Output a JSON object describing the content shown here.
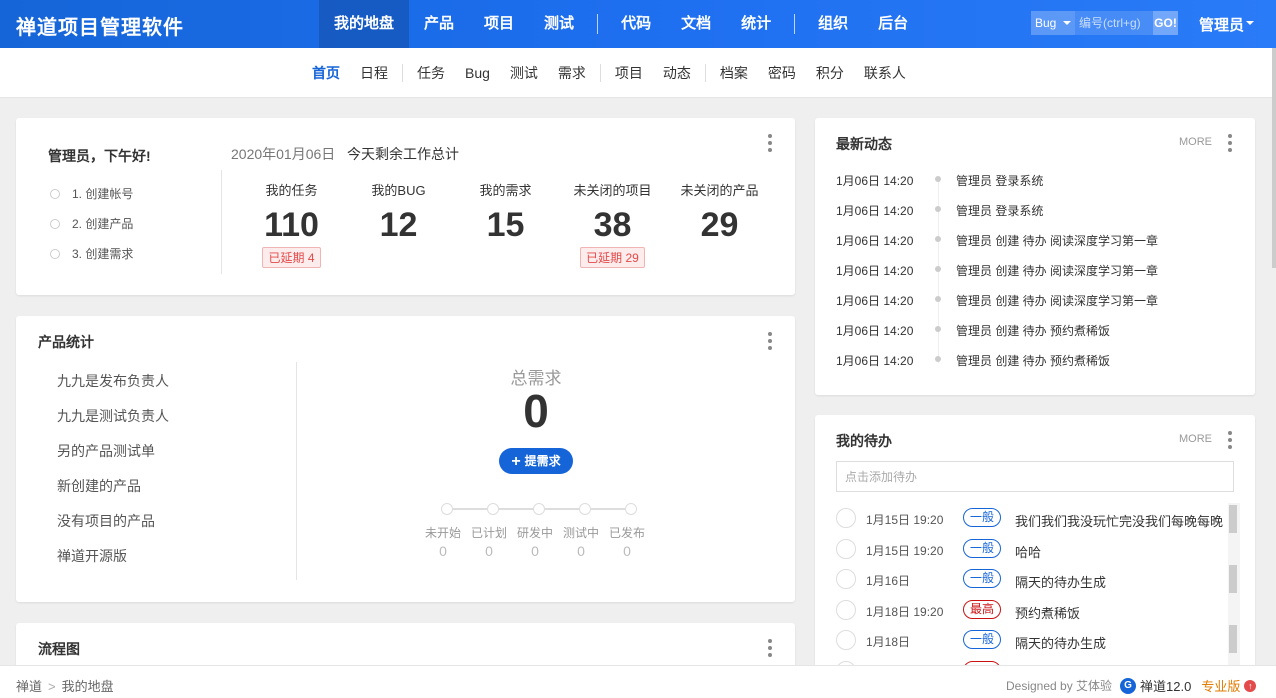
{
  "app": {
    "brand": "禅道项目管理软件"
  },
  "main_nav": [
    {
      "label": "我的地盘",
      "active": true
    },
    {
      "label": "产品"
    },
    {
      "label": "项目"
    },
    {
      "label": "测试"
    },
    {
      "label": "代码"
    },
    {
      "label": "文档"
    },
    {
      "label": "统计"
    },
    {
      "label": "组织"
    },
    {
      "label": "后台"
    }
  ],
  "search": {
    "type": "Bug",
    "placeholder": "编号(ctrl+g)",
    "go_label": "GO!"
  },
  "user": {
    "name": "管理员"
  },
  "sub_nav": [
    {
      "label": "首页",
      "active": true
    },
    {
      "label": "日程"
    },
    {
      "label": "任务"
    },
    {
      "label": "Bug"
    },
    {
      "label": "测试"
    },
    {
      "label": "需求"
    },
    {
      "label": "项目"
    },
    {
      "label": "动态"
    },
    {
      "label": "档案"
    },
    {
      "label": "密码"
    },
    {
      "label": "积分"
    },
    {
      "label": "联系人"
    }
  ],
  "welcome": {
    "greeting": "管理员，下午好!",
    "date": "2020年01月06日",
    "today_total": "今天剩余工作总计",
    "steps": [
      "1. 创建帐号",
      "2. 创建产品",
      "3. 创建需求"
    ],
    "stats": [
      {
        "label": "我的任务",
        "value": "110",
        "delay": "已延期 4"
      },
      {
        "label": "我的BUG",
        "value": "12",
        "delay": ""
      },
      {
        "label": "我的需求",
        "value": "15",
        "delay": ""
      },
      {
        "label": "未关闭的项目",
        "value": "38",
        "delay": "已延期 29"
      },
      {
        "label": "未关闭的产品",
        "value": "29",
        "delay": ""
      }
    ]
  },
  "product_stats": {
    "title": "产品统计",
    "products": [
      "九九是发布负责人",
      "九九是测试负责人",
      "另的产品测试单",
      "新创建的产品",
      "没有项目的产品",
      "禅道开源版"
    ],
    "total_label": "总需求",
    "total_value": "0",
    "add_story_label": "提需求",
    "stages": [
      {
        "label": "未开始",
        "value": "0"
      },
      {
        "label": "已计划",
        "value": "0"
      },
      {
        "label": "研发中",
        "value": "0"
      },
      {
        "label": "测试中",
        "value": "0"
      },
      {
        "label": "已发布",
        "value": "0"
      }
    ]
  },
  "flow": {
    "title": "流程图"
  },
  "dynamics": {
    "title": "最新动态",
    "more": "MORE",
    "items": [
      {
        "time": "1月06日 14:20",
        "content": "管理员 登录系统"
      },
      {
        "time": "1月06日 14:20",
        "content": "管理员 登录系统"
      },
      {
        "time": "1月06日 14:20",
        "content": "管理员 创建 待办 阅读深度学习第一章"
      },
      {
        "time": "1月06日 14:20",
        "content": "管理员 创建 待办 阅读深度学习第一章"
      },
      {
        "time": "1月06日 14:20",
        "content": "管理员 创建 待办 阅读深度学习第一章"
      },
      {
        "time": "1月06日 14:20",
        "content": "管理员 创建 待办 预约煮稀饭"
      },
      {
        "time": "1月06日 14:20",
        "content": "管理员 创建 待办 预约煮稀饭"
      }
    ]
  },
  "todos": {
    "title": "我的待办",
    "more": "MORE",
    "input_placeholder": "点击添加待办",
    "items": [
      {
        "date": "1月15日 19:20",
        "priority": "一般",
        "high": false,
        "name": "我们我们我没玩忙完没我们每晚每晚"
      },
      {
        "date": "1月15日 19:20",
        "priority": "一般",
        "high": false,
        "name": "哈哈"
      },
      {
        "date": "1月16日",
        "priority": "一般",
        "high": false,
        "name": "隔天的待办生成"
      },
      {
        "date": "1月18日 19:20",
        "priority": "最高",
        "high": true,
        "name": "预约煮稀饭"
      },
      {
        "date": "1月18日",
        "priority": "一般",
        "high": false,
        "name": "隔天的待办生成"
      },
      {
        "date": "",
        "priority": "",
        "high": true,
        "name": ""
      }
    ]
  },
  "footer": {
    "breadcrumb": [
      "禅道",
      "我的地盘"
    ],
    "designed_by": "Designed by 艾体验",
    "version": "禅道12.0",
    "edition": "专业版"
  }
}
